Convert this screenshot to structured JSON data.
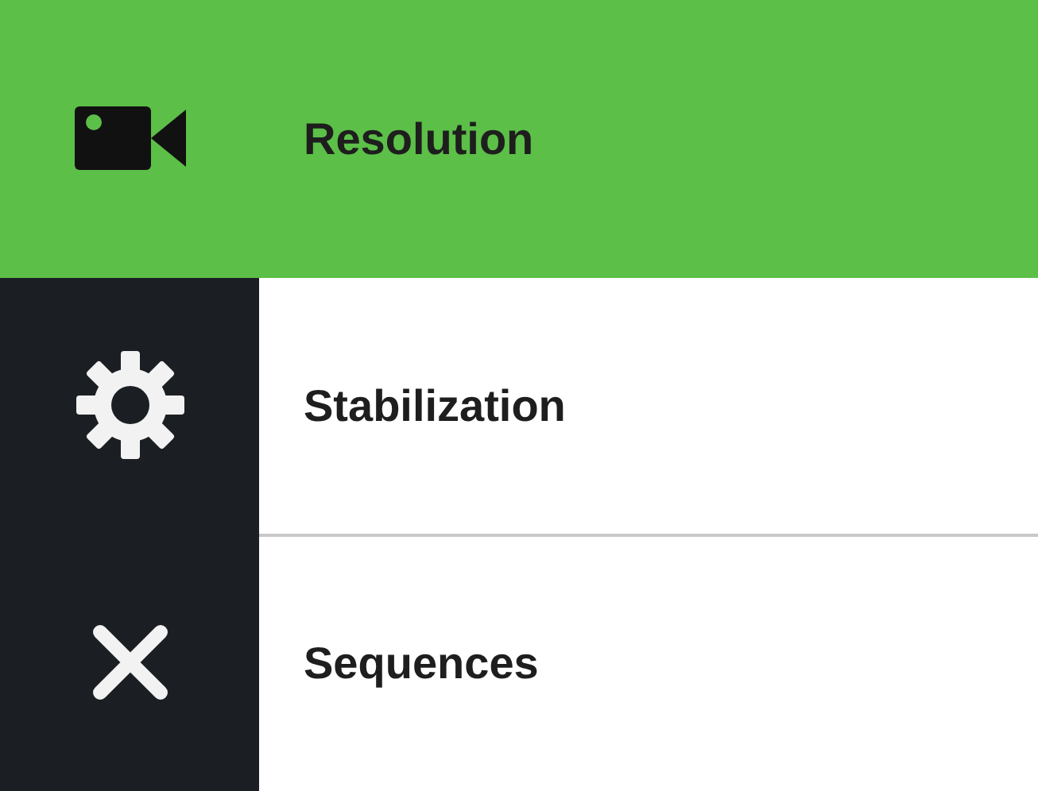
{
  "menu": {
    "items": [
      {
        "kind": "camera",
        "label": "Resolution",
        "selected": true
      },
      {
        "kind": "gear",
        "label": "Stabilization",
        "selected": false
      },
      {
        "kind": "close",
        "label": "Sequences",
        "selected": false
      }
    ]
  }
}
